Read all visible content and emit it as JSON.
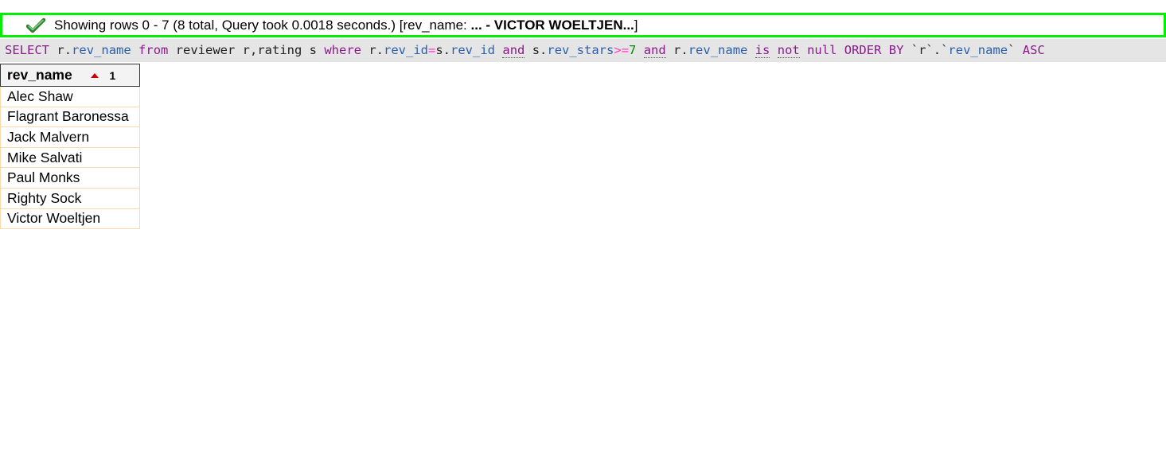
{
  "success": {
    "message": "Showing rows 0 - 7 (8 total, Query took 0.0018 seconds.) [rev_name:",
    "range": "... - VICTOR WOELTJEN...",
    "closing": "]",
    "icon": "check-icon"
  },
  "sql": {
    "tokens": [
      {
        "t": "SELECT",
        "c": "kw"
      },
      {
        "t": " ",
        "c": "plain"
      },
      {
        "t": "r",
        "c": "plain"
      },
      {
        "t": ".",
        "c": "plain"
      },
      {
        "t": "rev_name",
        "c": "col"
      },
      {
        "t": " ",
        "c": "plain"
      },
      {
        "t": "from",
        "c": "kw"
      },
      {
        "t": " reviewer r,rating s ",
        "c": "plain"
      },
      {
        "t": "where",
        "c": "kw"
      },
      {
        "t": " r.",
        "c": "plain"
      },
      {
        "t": "rev_id",
        "c": "col"
      },
      {
        "t": "=",
        "c": "op"
      },
      {
        "t": "s.",
        "c": "plain"
      },
      {
        "t": "rev_id",
        "c": "col"
      },
      {
        "t": " ",
        "c": "plain"
      },
      {
        "t": "and",
        "c": "kw dotted"
      },
      {
        "t": " s.",
        "c": "plain"
      },
      {
        "t": "rev_stars",
        "c": "col"
      },
      {
        "t": ">=",
        "c": "op"
      },
      {
        "t": "7",
        "c": "num"
      },
      {
        "t": " ",
        "c": "plain"
      },
      {
        "t": "and",
        "c": "kw dotted"
      },
      {
        "t": " r.",
        "c": "plain"
      },
      {
        "t": "rev_name",
        "c": "col"
      },
      {
        "t": " ",
        "c": "plain"
      },
      {
        "t": "is",
        "c": "kw dotted"
      },
      {
        "t": " ",
        "c": "plain"
      },
      {
        "t": "not",
        "c": "kw dotted"
      },
      {
        "t": " ",
        "c": "plain"
      },
      {
        "t": "null",
        "c": "kw"
      },
      {
        "t": " ",
        "c": "plain"
      },
      {
        "t": "ORDER BY",
        "c": "kw"
      },
      {
        "t": " `r`.`",
        "c": "plain"
      },
      {
        "t": "rev_name",
        "c": "col"
      },
      {
        "t": "` ",
        "c": "plain"
      },
      {
        "t": "ASC",
        "c": "kw"
      }
    ]
  },
  "table": {
    "header": "rev_name",
    "sort_order": "1",
    "rows": [
      "Alec Shaw",
      "Flagrant Baronessa",
      "Jack Malvern",
      "Mike Salvati",
      "Paul Monks",
      "Righty Sock",
      "Victor Woeltjen"
    ]
  }
}
